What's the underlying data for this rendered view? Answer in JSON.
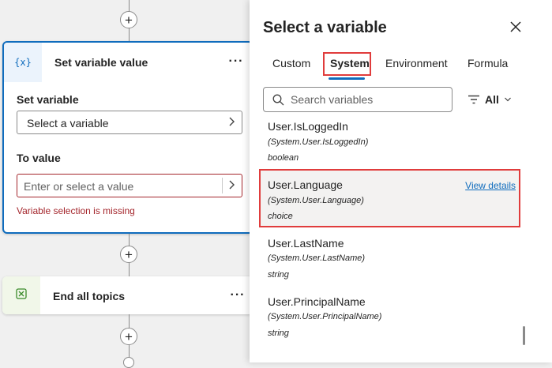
{
  "canvas": {
    "set_variable_node": {
      "icon": "variable-icon",
      "title": "Set variable value",
      "more": "···",
      "set_variable_label": "Set variable",
      "set_variable_value": "Select a variable",
      "to_value_label": "To value",
      "to_value_placeholder": "Enter or select a value",
      "error": "Variable selection is missing"
    },
    "end_node": {
      "icon": "end-conversation-icon",
      "title": "End all topics",
      "more": "···"
    },
    "add_label": "+"
  },
  "panel": {
    "title": "Select a variable",
    "tabs": [
      {
        "label": "Custom",
        "active": false
      },
      {
        "label": "System",
        "active": true
      },
      {
        "label": "Environment",
        "active": false
      },
      {
        "label": "Formula",
        "active": false
      }
    ],
    "search_placeholder": "Search variables",
    "filter_label": "All",
    "variables": [
      {
        "name": "User.IsLoggedIn",
        "path": "(System.User.IsLoggedIn)",
        "type": "boolean"
      },
      {
        "name": "User.Language",
        "path": "(System.User.Language)",
        "type": "choice",
        "highlighted": true,
        "action": "View details"
      },
      {
        "name": "User.LastName",
        "path": "(System.User.LastName)",
        "type": "string"
      },
      {
        "name": "User.PrincipalName",
        "path": "(System.User.PrincipalName)",
        "type": "string"
      }
    ]
  },
  "colors": {
    "accent": "#0f6cbd",
    "error": "#a4262c",
    "highlight_box": "#e03c3c"
  }
}
